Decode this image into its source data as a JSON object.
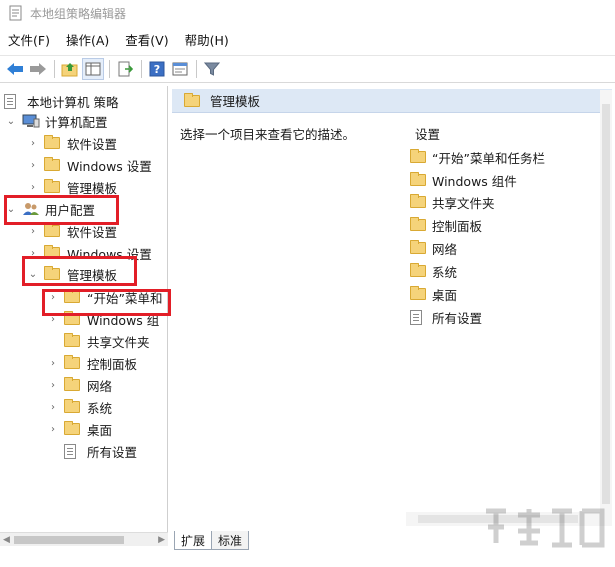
{
  "window": {
    "title": "本地组策略编辑器"
  },
  "menu": [
    {
      "label": "文件(F)"
    },
    {
      "label": "操作(A)"
    },
    {
      "label": "查看(V)"
    },
    {
      "label": "帮助(H)"
    }
  ],
  "toolbar": {
    "buttons": [
      "back-arrow-icon",
      "forward-arrow-icon",
      "up-folder-icon",
      "show-tree-icon",
      "export-list-icon",
      "help-icon",
      "properties-icon",
      "filter-icon"
    ]
  },
  "tree": {
    "root": "本地计算机 策略",
    "computer_config": "计算机配置",
    "cc_software": "软件设置",
    "cc_windows": "Windows 设置",
    "cc_admin": "管理模板",
    "user_config": "用户配置",
    "uc_software": "软件设置",
    "uc_windows": "Windows 设置",
    "uc_admin": "管理模板",
    "admin_children": [
      "“开始”菜单和",
      "Windows 组",
      "共享文件夹",
      "控制面板",
      "网络",
      "系统",
      "桌面",
      "所有设置"
    ]
  },
  "content": {
    "header": "管理模板",
    "description": "选择一个项目来查看它的描述。",
    "settings_column": "设置",
    "items": [
      "“开始”菜单和任务栏",
      "Windows 组件",
      "共享文件夹",
      "控制面板",
      "网络",
      "系统",
      "桌面",
      "所有设置"
    ]
  },
  "tabs": [
    "扩展",
    "标准"
  ],
  "colors": {
    "highlight": "#e21e27",
    "header_bg": "#dde8f5",
    "folder": "#f5d37a"
  }
}
